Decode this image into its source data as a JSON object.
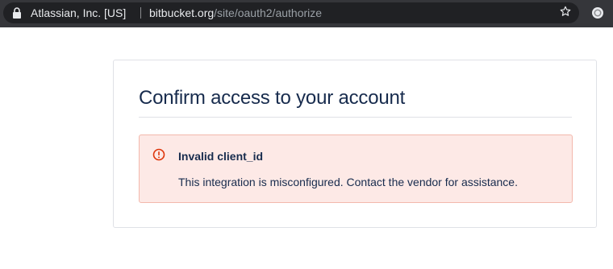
{
  "browser": {
    "certificate_owner": "Atlassian, Inc. [US]",
    "url_host": "bitbucket.org",
    "url_path": "/site/oauth2/authorize",
    "icons": {
      "lock": "lock-icon",
      "bookmark": "star-icon",
      "profile": "profile-icon"
    }
  },
  "page": {
    "title": "Confirm access to your account",
    "error": {
      "icon": "error-icon",
      "title": "Invalid client_id",
      "message": "This integration is misconfigured. Contact the vendor for assistance."
    }
  },
  "colors": {
    "heading": "#172b4d",
    "error_bg": "#fde9e6",
    "error_border": "#f3b8ac",
    "error_icon": "#de350b"
  }
}
